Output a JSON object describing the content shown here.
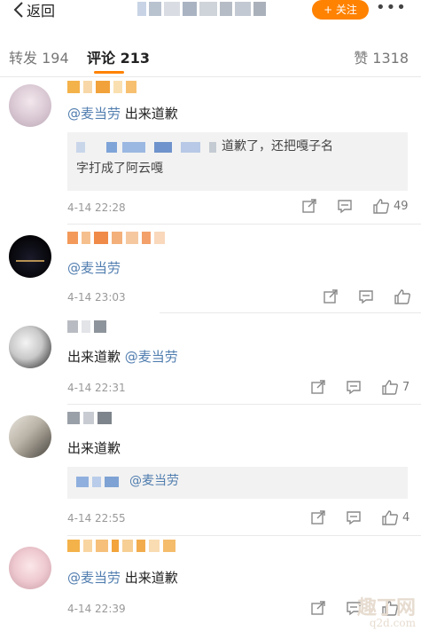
{
  "topbar": {
    "back_label": "返回",
    "follow_label": "+ 关注",
    "more_label": "•••"
  },
  "tabs": {
    "repost": "转发 194",
    "comment": "评论 213",
    "like": "赞 1318"
  },
  "comments": [
    {
      "text_prefix": "",
      "mention": "@麦当劳",
      "text_suffix": " 出来道歉",
      "quote_text": "道歉了，还把嘎子名",
      "quote_text2": "字打成了阿云嘎",
      "time": "4-14 22:28",
      "like_count": "49"
    },
    {
      "text_prefix": "",
      "mention": "@麦当劳",
      "text_suffix": "",
      "time": "4-14 23:03",
      "like_count": ""
    },
    {
      "text_prefix": "出来道歉 ",
      "mention": "@麦当劳",
      "text_suffix": "",
      "time": "4-14 22:31",
      "like_count": "7"
    },
    {
      "text_prefix": "出来道歉",
      "mention": "",
      "text_suffix": "",
      "quote_mention": "@麦当劳",
      "time": "4-14 22:55",
      "like_count": "4"
    },
    {
      "text_prefix": "",
      "mention": "@麦当劳",
      "text_suffix": " 出来道歉",
      "time": "4-14 22:39",
      "like_count": ""
    }
  ],
  "watermark": {
    "text": "趣丁网",
    "sub": "q2d.com"
  },
  "colors": {
    "accent": "#ff8200",
    "mention": "#507daf"
  }
}
